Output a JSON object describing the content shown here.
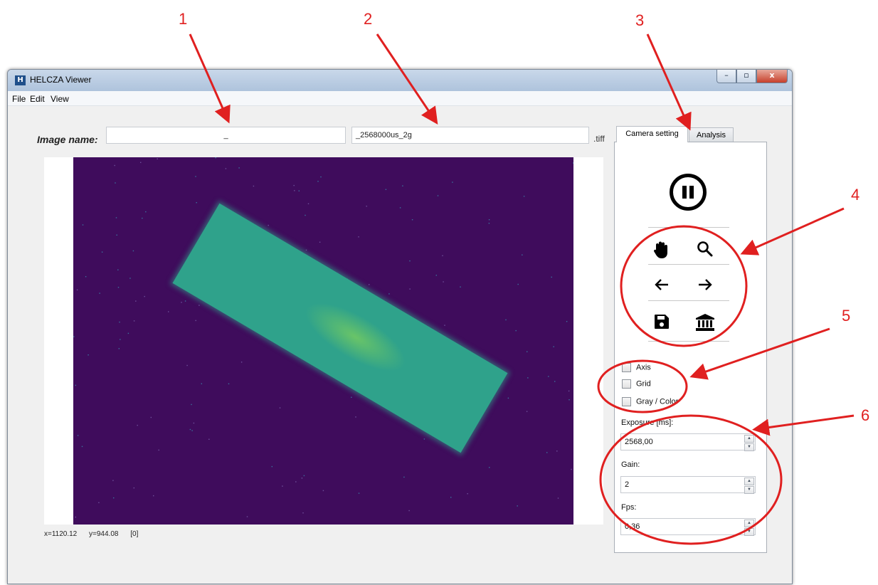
{
  "annotations": [
    "1",
    "2",
    "3",
    "4",
    "5",
    "6"
  ],
  "window": {
    "title": "HELCZA Viewer",
    "app_icon": "H"
  },
  "window_controls": {
    "minimize": "–",
    "maximize": "▫",
    "close": "x"
  },
  "menu": {
    "items": [
      "File",
      "Edit",
      "View"
    ]
  },
  "image_name": {
    "label": "Image name:",
    "prefix_value": "_",
    "suffix_value": "_2568000us_2g",
    "extension": ".tiff"
  },
  "status": {
    "x": "x=1120.12",
    "y": "y=944.08",
    "value": "[0]"
  },
  "tabs": [
    "Camera setting",
    "Analysis"
  ],
  "toolbar": {
    "pause_icon": "pause-icon",
    "icons": [
      "hand-pan-icon",
      "zoom-icon",
      "arrow-left-icon",
      "arrow-right-icon",
      "save-icon",
      "home-icon"
    ]
  },
  "checkboxes": [
    "Axis",
    "Grid",
    "Gray / Color"
  ],
  "settings": {
    "exposure_label": "Exposure [ms]:",
    "exposure_value": "2568,00",
    "gain_label": "Gain:",
    "gain_value": "2",
    "fps_label": "Fps:",
    "fps_value": "0,36"
  },
  "colors": {
    "annotation": "#e02020",
    "image_background": "#3f0c5c",
    "image_object": "#2fa28b",
    "image_highlight": "#78cd5f"
  }
}
